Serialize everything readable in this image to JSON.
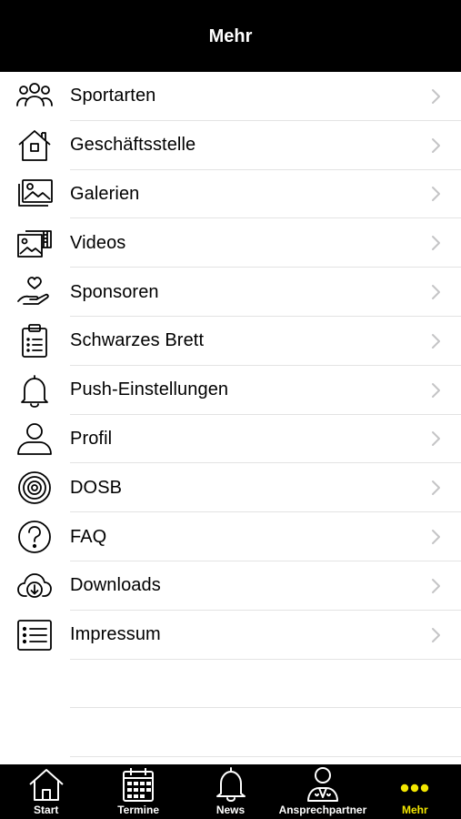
{
  "header": {
    "title": "Mehr"
  },
  "colors": {
    "header_bg": "#000000",
    "active_tab": "#f2e600",
    "divider": "#e3e3e3",
    "chevron": "#c4c4c6"
  },
  "menu": {
    "items": [
      {
        "label": "Sportarten",
        "icon": "group-icon"
      },
      {
        "label": "Geschäftsstelle",
        "icon": "house-icon"
      },
      {
        "label": "Galerien",
        "icon": "gallery-icon"
      },
      {
        "label": "Videos",
        "icon": "video-icon"
      },
      {
        "label": "Sponsoren",
        "icon": "heart-hand-icon"
      },
      {
        "label": "Schwarzes Brett",
        "icon": "clipboard-icon"
      },
      {
        "label": "Push-Einstellungen",
        "icon": "bell-icon"
      },
      {
        "label": "Profil",
        "icon": "person-icon"
      },
      {
        "label": "DOSB",
        "icon": "target-icon"
      },
      {
        "label": "FAQ",
        "icon": "question-icon"
      },
      {
        "label": "Downloads",
        "icon": "cloud-download-icon"
      },
      {
        "label": "Impressum",
        "icon": "list-icon"
      }
    ]
  },
  "tabbar": {
    "tabs": [
      {
        "label": "Start",
        "icon": "house-icon",
        "active": false
      },
      {
        "label": "Termine",
        "icon": "calendar-icon",
        "active": false
      },
      {
        "label": "News",
        "icon": "bell-icon",
        "active": false
      },
      {
        "label": "Ansprechpartner",
        "icon": "contact-person-icon",
        "active": false
      },
      {
        "label": "Mehr",
        "icon": "more-dots-icon",
        "active": true
      }
    ]
  }
}
